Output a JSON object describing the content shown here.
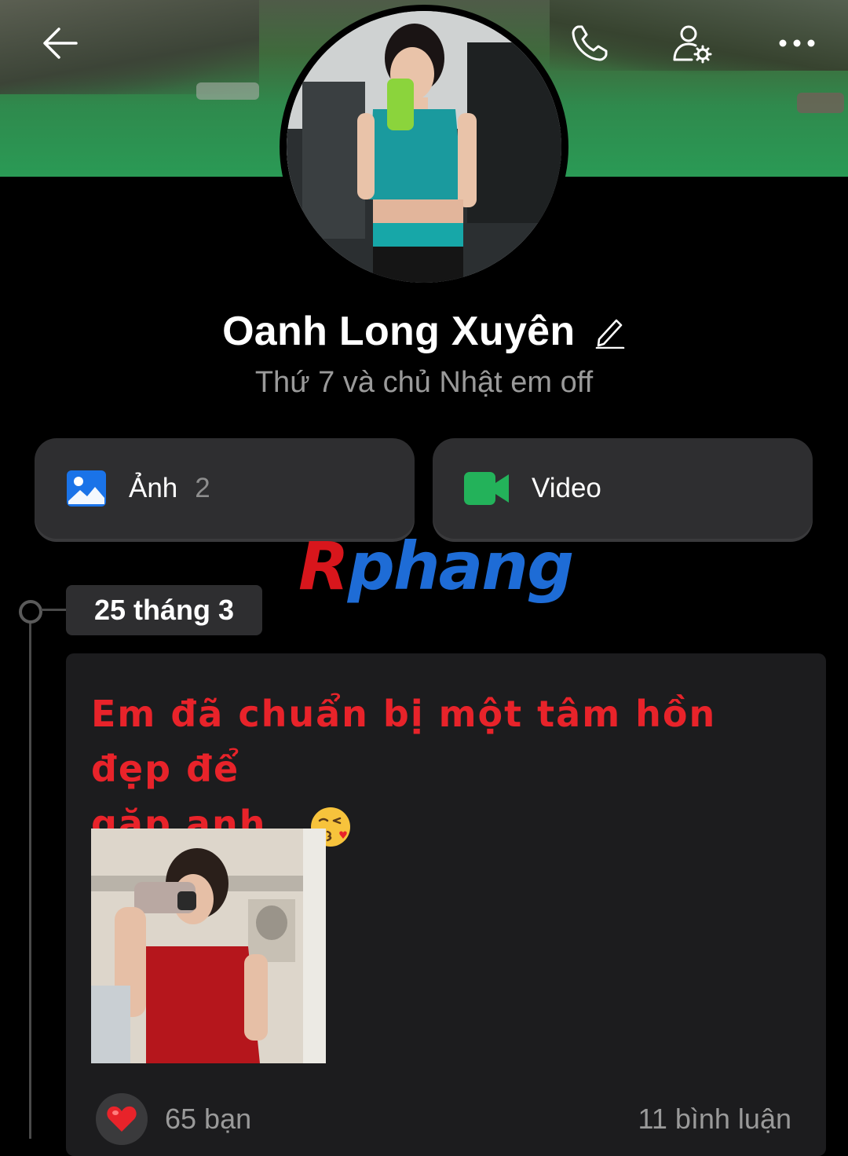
{
  "profile": {
    "name": "Oanh Long Xuyên",
    "status": "Thứ 7 và chủ Nhật em off"
  },
  "icons": {
    "back": "arrow-left-icon",
    "call": "phone-icon",
    "settings": "user-settings-icon",
    "more": "more-dots-icon",
    "edit": "pencil-icon",
    "photos": "image-icon",
    "video": "video-camera-icon",
    "reaction": "heart-icon"
  },
  "media": {
    "photos_label": "Ảnh",
    "photos_count": "2",
    "video_label": "Video"
  },
  "watermark": {
    "first": "R",
    "rest": "phang"
  },
  "timeline": {
    "date": "25 tháng 3"
  },
  "post": {
    "text_line1": "Em đã chuẩn bị một tâm hồn đẹp để",
    "text_line2": "gặp anh .",
    "reactions": "65 bạn",
    "comments": "11 bình luận"
  },
  "colors": {
    "background": "#000000",
    "card": "#1c1c1e",
    "button": "#2e2e30",
    "post_text": "#e8232a",
    "photo_icon": "#1a73e8",
    "video_icon": "#23b25a",
    "muted_text": "#9a9a9a"
  }
}
